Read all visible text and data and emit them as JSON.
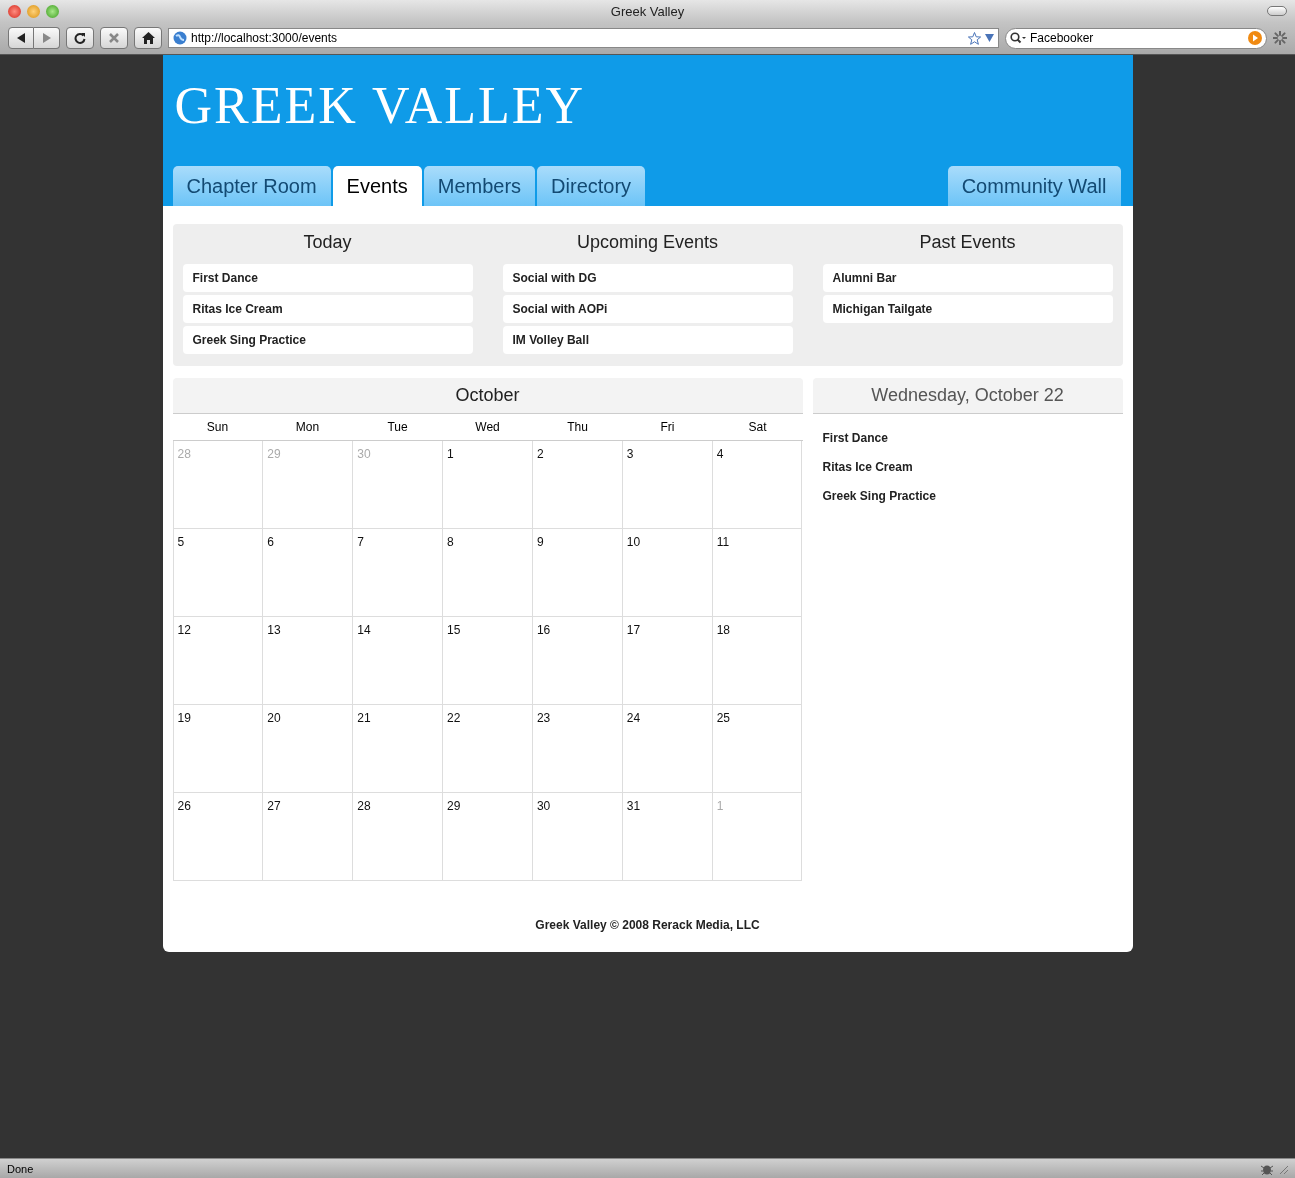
{
  "browser": {
    "title": "Greek Valley",
    "url": "http://localhost:3000/events",
    "search": "Facebooker",
    "status": "Done"
  },
  "site": {
    "logo": "GREEK VALLEY"
  },
  "tabs": [
    {
      "label": "Chapter Room",
      "selected": false
    },
    {
      "label": "Events",
      "selected": true
    },
    {
      "label": "Members",
      "selected": false
    },
    {
      "label": "Directory",
      "selected": false
    }
  ],
  "right_tabs": [
    {
      "label": "Community Wall",
      "selected": false
    }
  ],
  "event_lists": [
    {
      "title": "Today",
      "items": [
        "First Dance",
        "Ritas Ice Cream",
        "Greek Sing Practice"
      ]
    },
    {
      "title": "Upcoming Events",
      "items": [
        "Social with DG",
        "Social with AOPi",
        "IM Volley Ball"
      ]
    },
    {
      "title": "Past Events",
      "items": [
        "Alumni Bar",
        "Michigan Tailgate"
      ]
    }
  ],
  "calendar": {
    "month": "October",
    "weekdays": [
      "Sun",
      "Mon",
      "Tue",
      "Wed",
      "Thu",
      "Fri",
      "Sat"
    ],
    "weeks": [
      [
        {
          "day": "28",
          "outside_month": true
        },
        {
          "day": "29",
          "outside_month": true
        },
        {
          "day": "30",
          "outside_month": true
        },
        {
          "day": "1",
          "outside_month": false
        },
        {
          "day": "2",
          "outside_month": false
        },
        {
          "day": "3",
          "outside_month": false
        },
        {
          "day": "4",
          "outside_month": false
        }
      ],
      [
        {
          "day": "5",
          "outside_month": false
        },
        {
          "day": "6",
          "outside_month": false
        },
        {
          "day": "7",
          "outside_month": false
        },
        {
          "day": "8",
          "outside_month": false
        },
        {
          "day": "9",
          "outside_month": false
        },
        {
          "day": "10",
          "outside_month": false
        },
        {
          "day": "11",
          "outside_month": false
        }
      ],
      [
        {
          "day": "12",
          "outside_month": false
        },
        {
          "day": "13",
          "outside_month": false
        },
        {
          "day": "14",
          "outside_month": false
        },
        {
          "day": "15",
          "outside_month": false
        },
        {
          "day": "16",
          "outside_month": false
        },
        {
          "day": "17",
          "outside_month": false
        },
        {
          "day": "18",
          "outside_month": false
        }
      ],
      [
        {
          "day": "19",
          "outside_month": false
        },
        {
          "day": "20",
          "outside_month": false
        },
        {
          "day": "21",
          "outside_month": false
        },
        {
          "day": "22",
          "outside_month": false
        },
        {
          "day": "23",
          "outside_month": false
        },
        {
          "day": "24",
          "outside_month": false
        },
        {
          "day": "25",
          "outside_month": false
        }
      ],
      [
        {
          "day": "26",
          "outside_month": false
        },
        {
          "day": "27",
          "outside_month": false
        },
        {
          "day": "28",
          "outside_month": false
        },
        {
          "day": "29",
          "outside_month": false
        },
        {
          "day": "30",
          "outside_month": false
        },
        {
          "day": "31",
          "outside_month": false
        },
        {
          "day": "1",
          "outside_month": true
        }
      ]
    ]
  },
  "day_panel": {
    "title": "Wednesday, October 22",
    "items": [
      "First Dance",
      "Ritas Ice Cream",
      "Greek Sing Practice"
    ]
  },
  "footer": "Greek Valley © 2008 Rerack Media, LLC"
}
